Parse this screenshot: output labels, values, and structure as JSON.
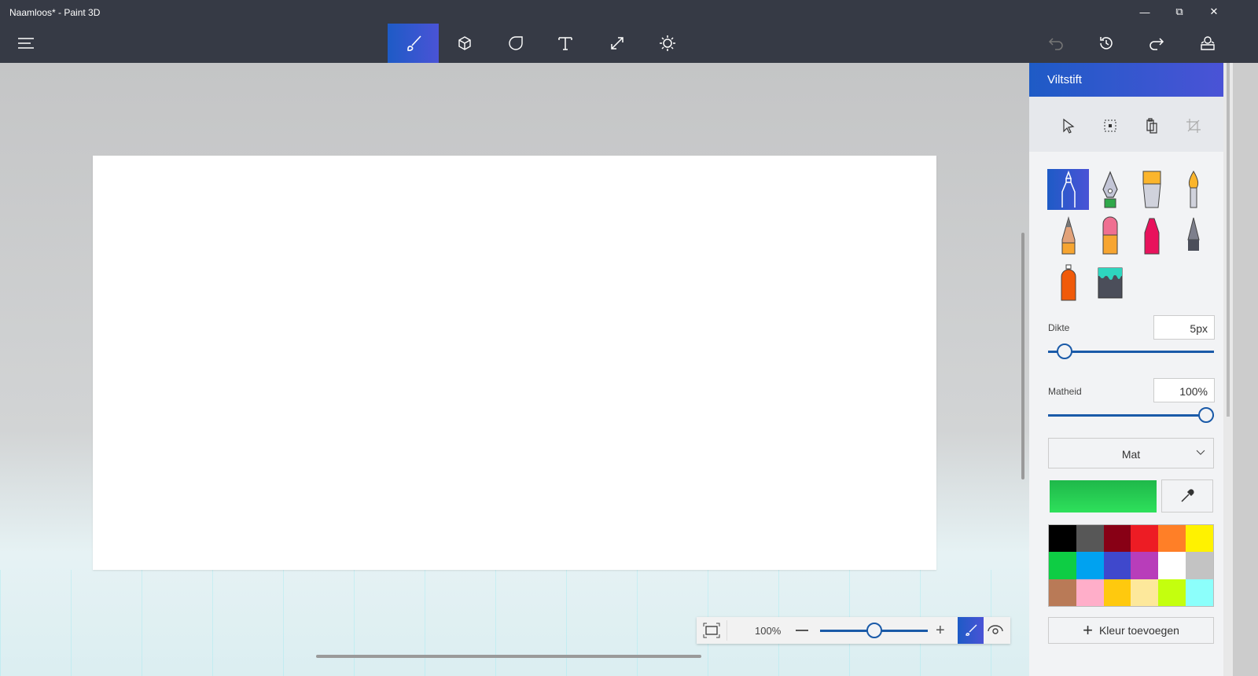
{
  "window": {
    "title": "Naamloos* - Paint 3D"
  },
  "toolbar": {
    "tools": [
      "brushes",
      "3d-shapes",
      "stickers",
      "text",
      "canvas",
      "effects"
    ],
    "active": "brushes"
  },
  "panel": {
    "title": "Viltstift",
    "thickness": {
      "label": "Dikte",
      "value": "5px",
      "fraction": 0.06
    },
    "opacity": {
      "label": "Matheid",
      "value": "100%",
      "fraction": 1.0
    },
    "finish": "Mat",
    "current_color": "#28c94f",
    "add_color": "Kleur toevoegen",
    "palette": [
      "#000000",
      "#575757",
      "#880015",
      "#ed1c24",
      "#ff7f27",
      "#fff200",
      "#0ecd44",
      "#00a2f0",
      "#3f48cc",
      "#b83dba",
      "#ffffff",
      "#c3c3c3",
      "#b97a57",
      "#ffaec9",
      "#ffc90e",
      "#fde89b",
      "#c4ff0e",
      "#8cfffb"
    ]
  },
  "zoom": {
    "value": "100%",
    "fraction": 0.5
  }
}
